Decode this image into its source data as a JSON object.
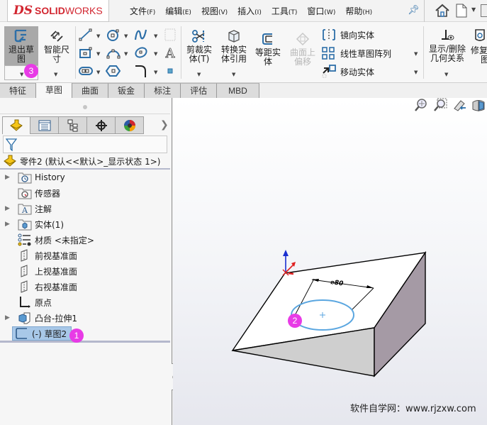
{
  "app": {
    "brand_prefix": "DS",
    "brand_bold": "SOLID",
    "brand_light": "WORKS"
  },
  "menu": [
    {
      "label": "文件",
      "key": "(F)"
    },
    {
      "label": "编辑",
      "key": "(E)"
    },
    {
      "label": "视图",
      "key": "(V)"
    },
    {
      "label": "插入",
      "key": "(I)"
    },
    {
      "label": "工具",
      "key": "(T)"
    },
    {
      "label": "窗口",
      "key": "(W)"
    },
    {
      "label": "帮助",
      "key": "(H)"
    }
  ],
  "ribbon": {
    "exit_sketch": [
      "退出草",
      "图"
    ],
    "smart_dimension": [
      "智能尺",
      "寸"
    ],
    "trim_entities": [
      "剪裁实",
      "体(T)"
    ],
    "convert_entities": [
      "转换实",
      "体引用"
    ],
    "offset_entities": [
      "等距实",
      "体"
    ],
    "offset_on_surface": [
      "曲面上",
      "偏移"
    ],
    "mirror_entities": "镜向实体",
    "linear_pattern": "线性草图阵列",
    "move_entities": "移动实体",
    "display_relations": [
      "显示/删除",
      "几何关系"
    ],
    "repair_sketch": [
      "修复",
      "图"
    ]
  },
  "command_tabs": [
    {
      "label": "特征",
      "active": false
    },
    {
      "label": "草图",
      "active": true
    },
    {
      "label": "曲面",
      "active": false
    },
    {
      "label": "钣金",
      "active": false
    },
    {
      "label": "标注",
      "active": false
    },
    {
      "label": "评估",
      "active": false
    },
    {
      "label": "MBD",
      "active": false
    }
  ],
  "feature_tree": {
    "root": "零件2  (默认<<默认>_显示状态 1>)",
    "items": [
      {
        "label": "History",
        "expandable": true,
        "icon": "history-folder-icon"
      },
      {
        "label": "传感器",
        "expandable": false,
        "icon": "sensor-folder-icon"
      },
      {
        "label": "注解",
        "expandable": true,
        "icon": "annotation-folder-icon"
      },
      {
        "label": "实体(1)",
        "expandable": true,
        "icon": "solid-bodies-folder-icon"
      },
      {
        "label": "材质 <未指定>",
        "expandable": false,
        "icon": "material-icon"
      },
      {
        "label": "前视基准面",
        "expandable": false,
        "icon": "plane-icon"
      },
      {
        "label": "上视基准面",
        "expandable": false,
        "icon": "plane-icon"
      },
      {
        "label": "右视基准面",
        "expandable": false,
        "icon": "plane-icon"
      },
      {
        "label": "原点",
        "expandable": false,
        "icon": "origin-icon"
      },
      {
        "label": "凸台-拉伸1",
        "expandable": true,
        "icon": "extrude-icon"
      },
      {
        "label": "(-) 草图2",
        "expandable": false,
        "icon": "sketch-icon",
        "selected": true
      }
    ]
  },
  "viewport": {
    "dimension_label": "⌀80",
    "watermark": "软件自学网：www.rjzxw.com"
  },
  "badges": {
    "tree": "1",
    "circle": "2",
    "exit": "3"
  },
  "colors": {
    "brand": "#d22630",
    "badge": "#e83be6",
    "sketch_circle": "#5aa6e0",
    "selection": "#a8c8e8"
  }
}
